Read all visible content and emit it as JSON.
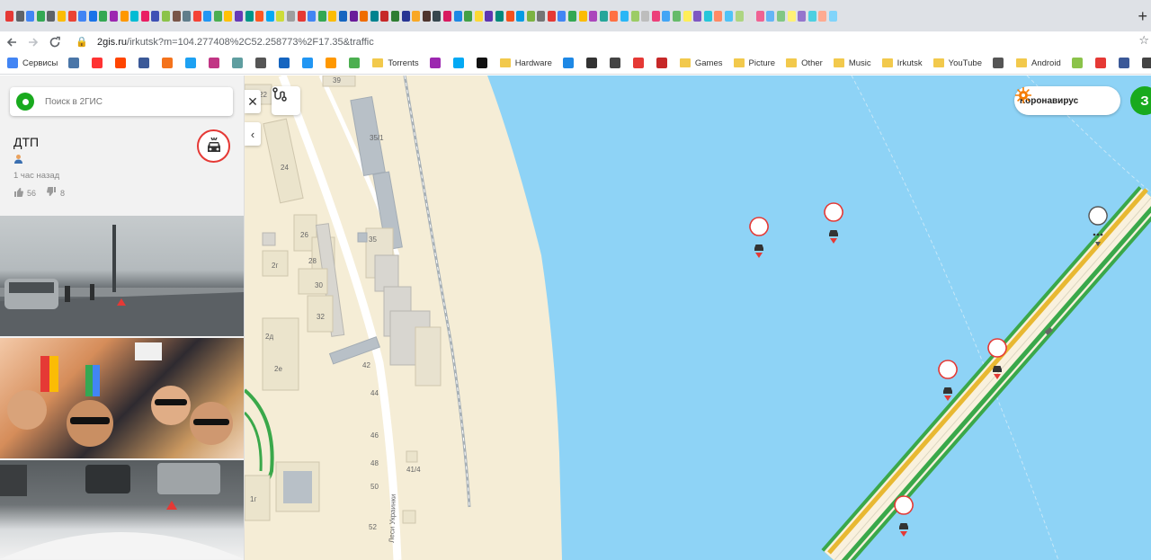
{
  "browser": {
    "url_host": "2gis.ru",
    "url_path": "/irkutsk?m=104.277408%2C52.258773%2F17.35&traffic",
    "tab_colors": [
      "#e53935",
      "#5f6368",
      "#4285f4",
      "#34a853",
      "#5f6368",
      "#fbbc05",
      "#ea4335",
      "#4285f4",
      "#1a73e8",
      "#34a853",
      "#9c27b0",
      "#ff9800",
      "#00bcd4",
      "#e91e63",
      "#3f51b5",
      "#8bc34a",
      "#795548",
      "#607d8b",
      "#f44336",
      "#2196f3",
      "#4caf50",
      "#ffc107",
      "#673ab7",
      "#009688",
      "#ff5722",
      "#03a9f4",
      "#cddc39",
      "#9e9e9e",
      "#e53935",
      "#4285f4",
      "#34a853",
      "#fbbc05",
      "#1565c0",
      "#6a1b9a",
      "#ef6c00",
      "#00838f",
      "#c62828",
      "#2e7d32",
      "#283593",
      "#f9a825",
      "#4e342e",
      "#37474f",
      "#d81b60",
      "#1e88e5",
      "#43a047",
      "#fdd835",
      "#5e35b1",
      "#00897b",
      "#f4511e",
      "#039be5",
      "#7cb342",
      "#757575",
      "#e53935",
      "#4285f4",
      "#34a853",
      "#fbbc05",
      "#ab47bc",
      "#26a69a",
      "#ff7043",
      "#29b6f6",
      "#9ccc65",
      "#bdbdbd",
      "#ec407a",
      "#42a5f5",
      "#66bb6a",
      "#ffee58",
      "#7e57c2",
      "#26c6da",
      "#ff8a65",
      "#4fc3f7",
      "#aed581",
      "#e0e0e0",
      "#f06292",
      "#64b5f6",
      "#81c784",
      "#fff176",
      "#9575cd",
      "#4dd0e1",
      "#ffab91",
      "#81d4fa"
    ]
  },
  "bookmarks": [
    {
      "label": "Сервисы",
      "color": "#4285f4"
    },
    {
      "label": "",
      "color": "#4a76a8"
    },
    {
      "label": "",
      "color": "#ff3333"
    },
    {
      "label": "",
      "color": "#ff4500"
    },
    {
      "label": "",
      "color": "#3b5998"
    },
    {
      "label": "",
      "color": "#f4731c"
    },
    {
      "label": "",
      "color": "#1da1f2"
    },
    {
      "label": "",
      "color": "#c13584"
    },
    {
      "label": "",
      "color": "#5f9ea0"
    },
    {
      "label": "",
      "color": "#555"
    },
    {
      "label": "",
      "color": "#1565c0"
    },
    {
      "label": "",
      "color": "#2196f3"
    },
    {
      "label": "",
      "color": "#ff9800"
    },
    {
      "label": "",
      "color": "#4caf50"
    },
    {
      "label": "Torrents",
      "folder": true
    },
    {
      "label": "",
      "color": "#9c27b0"
    },
    {
      "label": "",
      "color": "#03a9f4"
    },
    {
      "label": "",
      "color": "#111"
    },
    {
      "label": "Hardware",
      "folder": true
    },
    {
      "label": "",
      "color": "#1e88e5"
    },
    {
      "label": "",
      "color": "#333"
    },
    {
      "label": "",
      "color": "#444"
    },
    {
      "label": "",
      "color": "#e53935"
    },
    {
      "label": "",
      "color": "#c62828"
    },
    {
      "label": "Games",
      "folder": true
    },
    {
      "label": "Picture",
      "folder": true
    },
    {
      "label": "Other",
      "folder": true
    },
    {
      "label": "Music",
      "folder": true
    },
    {
      "label": "Irkutsk",
      "folder": true
    },
    {
      "label": "YouTube",
      "folder": true
    },
    {
      "label": "",
      "color": "#555"
    },
    {
      "label": "Android",
      "folder": true
    },
    {
      "label": "",
      "color": "#8bc34a"
    },
    {
      "label": "",
      "color": "#e53935"
    },
    {
      "label": "",
      "color": "#3b5998"
    },
    {
      "label": "",
      "color": "#444"
    }
  ],
  "search": {
    "placeholder": "Поиск в 2ГИС"
  },
  "card": {
    "title": "ДТП",
    "time": "1 час назад",
    "likes": "56",
    "dislikes": "8"
  },
  "map": {
    "covid_label": "Коронавирус",
    "login_label": "З",
    "street_label": "Леси Украинки",
    "buildings": [
      "22",
      "39",
      "35/1",
      "24",
      "26",
      "2г",
      "28",
      "35",
      "30",
      "32",
      "2д",
      "2е",
      "42",
      "44",
      "46",
      "48",
      "41/4",
      "50",
      "52",
      "1г"
    ]
  },
  "colors": {
    "water": "#8ed3f6",
    "land": "#f5edd6",
    "road_yellow": "#e8b832",
    "road_green": "#3aa84a",
    "accent_green": "#19aa1e",
    "incident_red": "#e53935"
  }
}
